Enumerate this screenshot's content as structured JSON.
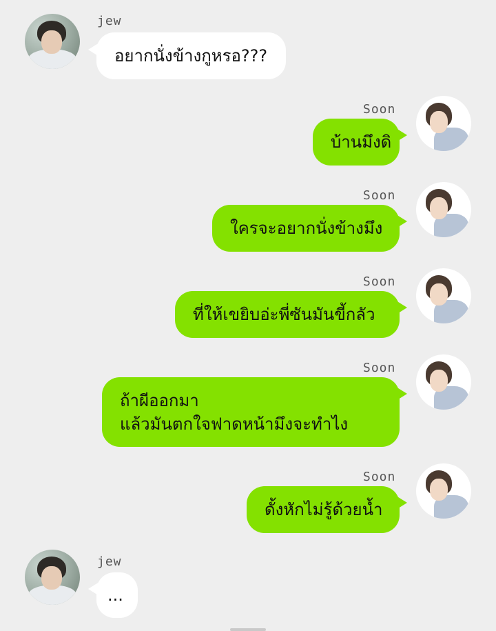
{
  "messages": [
    {
      "sender": "jew",
      "text": [
        "อยากนั่งข้างกูหรอ???"
      ]
    },
    {
      "sender": "Soon",
      "text": [
        "บ้านมึงดิ"
      ]
    },
    {
      "sender": "Soon",
      "text": [
        "ใครจะอยากนั่งข้างมึง"
      ]
    },
    {
      "sender": "Soon",
      "text": [
        "ที่ให้เขยิบอ่ะพี่ซันมันขี้กลัว"
      ]
    },
    {
      "sender": "Soon",
      "text": [
        "ถ้าผีออกมา",
        "แล้วมันตกใจฟาดหน้ามึงจะทำไง"
      ]
    },
    {
      "sender": "Soon",
      "text": [
        "ดั้งหักไม่รู้ด้วยน้ำ"
      ]
    },
    {
      "sender": "jew",
      "text": [
        "..."
      ]
    }
  ],
  "colors": {
    "background": "#eeeeee",
    "outgoing_bubble": "#84e100",
    "incoming_bubble": "#ffffff"
  }
}
